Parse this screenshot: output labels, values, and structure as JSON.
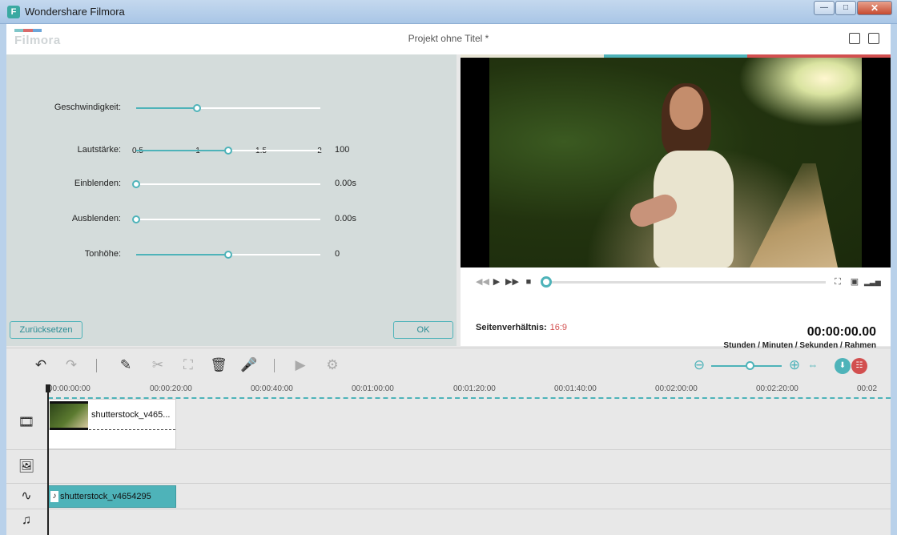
{
  "window": {
    "title": "Wondershare Filmora",
    "icon_letter": "F"
  },
  "header": {
    "logo_text": "Filmora",
    "project_title": "Projekt ohne Titel *"
  },
  "colors": {
    "accent": "#4eb3b9",
    "red": "#d24f4f",
    "panel": "#d4dcdb"
  },
  "settings": {
    "speed": {
      "label": "Geschwindigkeit:",
      "ticks": [
        "0.5",
        "1",
        "1.5",
        "2"
      ],
      "position": 0.33
    },
    "volume": {
      "label": "Lautstärke:",
      "value": "100",
      "position": 0.5
    },
    "fade_in": {
      "label": "Einblenden:",
      "value": "0.00s",
      "position": 0
    },
    "fade_out": {
      "label": "Ausblenden:",
      "value": "0.00s",
      "position": 0
    },
    "pitch": {
      "label": "Tonhöhe:",
      "value": "0",
      "position": 0.5
    },
    "reset_label": "Zurücksetzen",
    "ok_label": "OK"
  },
  "preview": {
    "aspect_label": "Seitenverhältnis:",
    "aspect_value": "16:9",
    "timecode": "00:00:00.00",
    "timecode_units": "Stunden / Minuten / Sekunden / Rahmen",
    "progress": 0
  },
  "timeline": {
    "ruler_labels": [
      "00:00:00:00",
      "00:00:20:00",
      "00:00:40:00",
      "00:01:00:00",
      "00:01:20:00",
      "00:01:40:00",
      "00:02:00:00",
      "00:02:20:00",
      "00:02"
    ],
    "video_clip_name": "shutterstock_v465...",
    "audio_clip_name": "shutterstock_v4654295",
    "zoom_position": 0.5
  }
}
